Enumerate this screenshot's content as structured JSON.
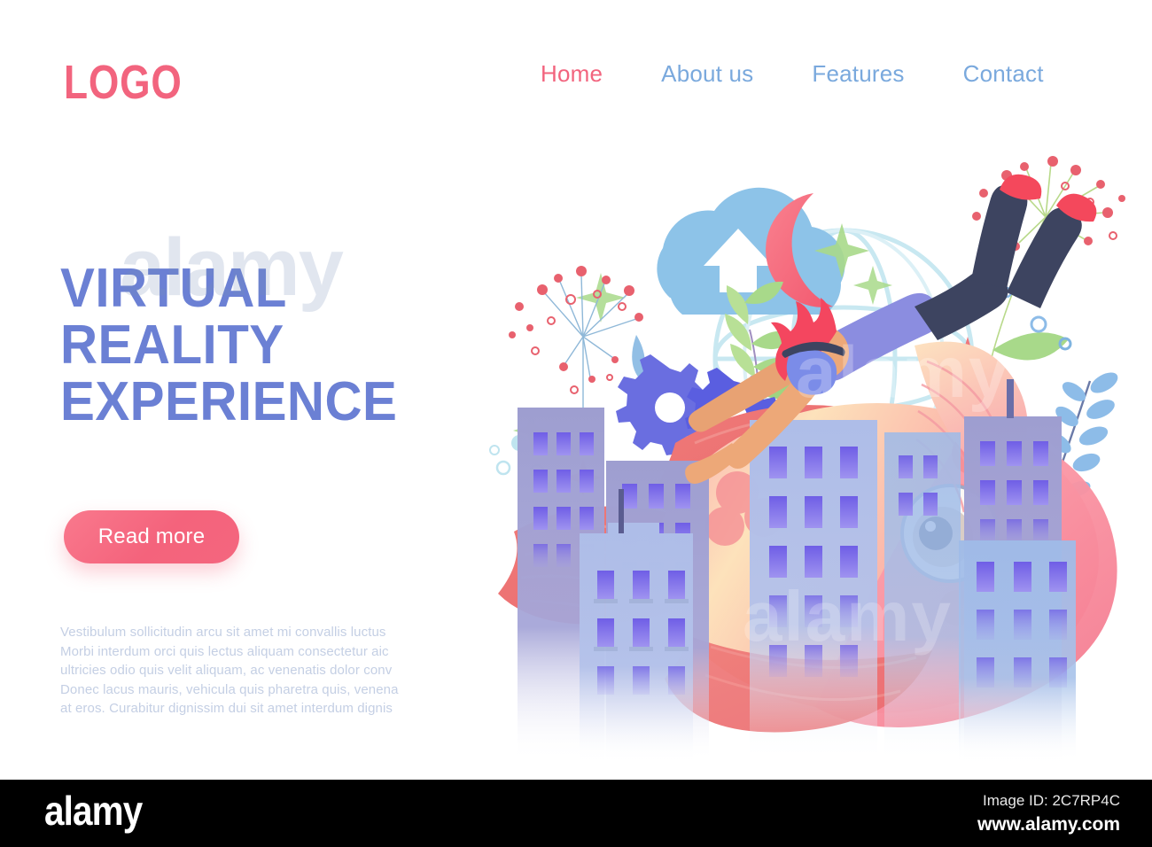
{
  "brand": {
    "logo": "LOGO",
    "logo_color": "#f2647e"
  },
  "nav": {
    "items": [
      {
        "label": "Home",
        "active": true
      },
      {
        "label": "About us",
        "active": false
      },
      {
        "label": "Features",
        "active": false
      },
      {
        "label": "Contact",
        "active": false
      }
    ],
    "active_color": "#f2647e",
    "inactive_color": "#7aa9dd"
  },
  "hero": {
    "heading_line1": "VIRTUAL",
    "heading_line2": "REALITY",
    "heading_line3": "EXPERIENCE",
    "heading_color": "#6b80d4",
    "cta_label": "Read more",
    "cta_color": "#f4637c",
    "paragraph_lines": [
      "Vestibulum sollicitudin arcu sit amet mi convallis luctus",
      "Morbi interdum orci quis lectus aliquam consectetur aic",
      "ultricies odio quis velit aliquam, ac venenatis dolor conv",
      "Donec lacus mauris, vehicula quis pharetra quis, venena",
      "at eros. Curabitur dignissim dui sit amet interdum dignis"
    ],
    "paragraph_color": "#c4cfe4"
  },
  "illustration": {
    "description": "Virtual reality scene: diver with VR headset over a city with giant fish",
    "elements": [
      {
        "name": "cloud-upload-icon",
        "color": "#8dc3e8"
      },
      {
        "name": "crescent-moon-icon",
        "color": "#f4687f"
      },
      {
        "name": "globe-wireframe-icon",
        "color": "#bfe4ef"
      },
      {
        "name": "vr-diver-figure",
        "hair": "#f4465f",
        "shirt": "#8b8de0",
        "pants": "#3d4460",
        "skin": "#eda878",
        "shoes": "#f4485c",
        "headset": "#7b8ce8"
      },
      {
        "name": "giant-fish",
        "body_from": "#fddcb0",
        "body_to": "#f58a9a",
        "fin": "#ec6f72",
        "eye": "#3d4a6b"
      },
      {
        "name": "city-buildings",
        "facade": "#a8c4e8",
        "window": "#7b6ce8"
      },
      {
        "name": "gear-icon",
        "color": "#6a6ee0"
      },
      {
        "name": "berry-flower",
        "color": "#e8616e"
      },
      {
        "name": "fern-leaf",
        "color": "#8dbce8"
      },
      {
        "name": "green-leaves",
        "color": "#a8d98a"
      },
      {
        "name": "sparkle-icon",
        "color": "#a8d98a"
      },
      {
        "name": "bubbles",
        "color": "#bfe4ef"
      }
    ]
  },
  "watermark": {
    "overlay_text": "alamy",
    "bar_brand": "alamy",
    "image_id_label": "Image ID: 2C7RP4C",
    "url": "www.alamy.com"
  }
}
